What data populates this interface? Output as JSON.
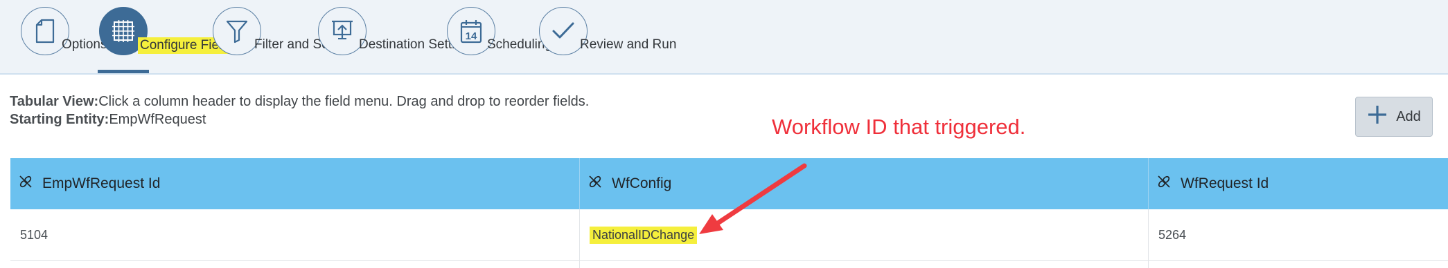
{
  "wizard": {
    "steps": [
      {
        "label": "Options",
        "icon": "document-icon"
      },
      {
        "label": "Configure Fields",
        "icon": "table-grid-icon",
        "active": true
      },
      {
        "label": "Filter and Sort",
        "icon": "filter-icon"
      },
      {
        "label": "Destination Settings",
        "icon": "presentation-upload-icon"
      },
      {
        "label": "Scheduling",
        "icon": "calendar-icon",
        "calendar_day": "14"
      },
      {
        "label": "Review and Run",
        "icon": "checkmark-icon"
      }
    ]
  },
  "info": {
    "tabular_label": "Tabular View:",
    "tabular_text": "Click a column header to display the field menu. Drag and drop to reorder fields.",
    "entity_label": "Starting Entity:",
    "entity_value": "EmpWfRequest"
  },
  "add_button": {
    "label": "Add",
    "icon": "plus-icon"
  },
  "annotation": {
    "text": "Workflow ID that triggered.",
    "color": "#ef2f3a"
  },
  "table": {
    "columns": [
      {
        "label": "EmpWfRequest Id",
        "icon": "unlink-icon"
      },
      {
        "label": "WfConfig",
        "icon": "unlink-icon"
      },
      {
        "label": "WfRequest Id",
        "icon": "unlink-icon"
      }
    ],
    "rows": [
      [
        "5104",
        "NationalIDChange",
        "5264"
      ]
    ]
  },
  "colors": {
    "header_bg": "#eef3f8",
    "active_step": "#3d6b96",
    "table_header": "#6bc1ef",
    "highlight": "#f5ef3c"
  }
}
